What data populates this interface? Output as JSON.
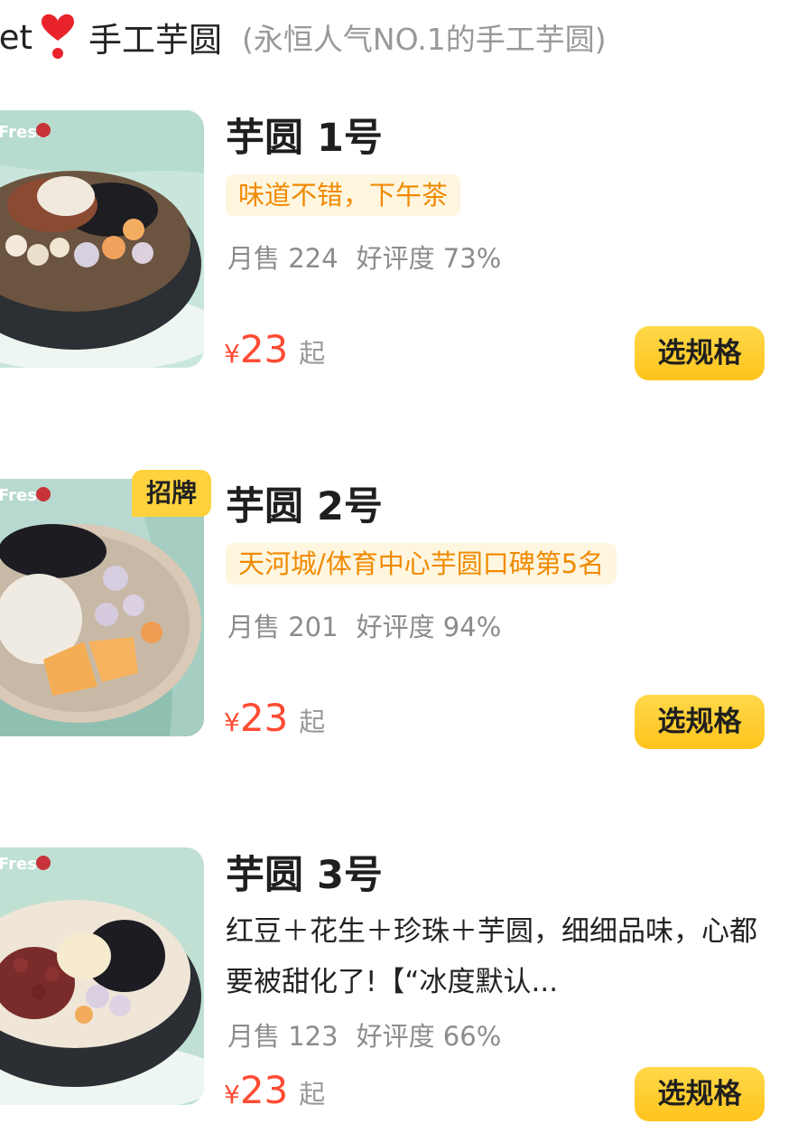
{
  "section": {
    "name": "eet",
    "heart_icon": "heart-exclamation-icon",
    "category": "手工芋圆",
    "subtitle": "(永恒人气NO.1的手工芋圆)"
  },
  "items": [
    {
      "name": "芋圆 1号",
      "tag": "味道不错，下午茶",
      "monthly_sales": "月售 224",
      "rating": "好评度 73%",
      "currency": "¥",
      "price": "23",
      "price_suffix": "起",
      "button_label": "选规格"
    },
    {
      "name": "芋圆 2号",
      "badge": "招牌",
      "tag": "天河城/体育中心芋圆口碑第5名",
      "monthly_sales": "月售 201",
      "rating": "好评度 94%",
      "currency": "¥",
      "price": "23",
      "price_suffix": "起",
      "button_label": "选规格"
    },
    {
      "name": "芋圆 3号",
      "description": "红豆＋花生＋珍珠＋芋圆，细细品味，心都要被甜化了!【“冰度默认...",
      "monthly_sales": "月售 123",
      "rating": "好评度 66%",
      "currency": "¥",
      "price": "23",
      "price_suffix": "起",
      "button_label": "选规格"
    }
  ],
  "colors": {
    "price": "#ff4b33",
    "tag_text": "#f08a00",
    "tag_bg": "#fff6e0",
    "button": "#ffc41c"
  }
}
